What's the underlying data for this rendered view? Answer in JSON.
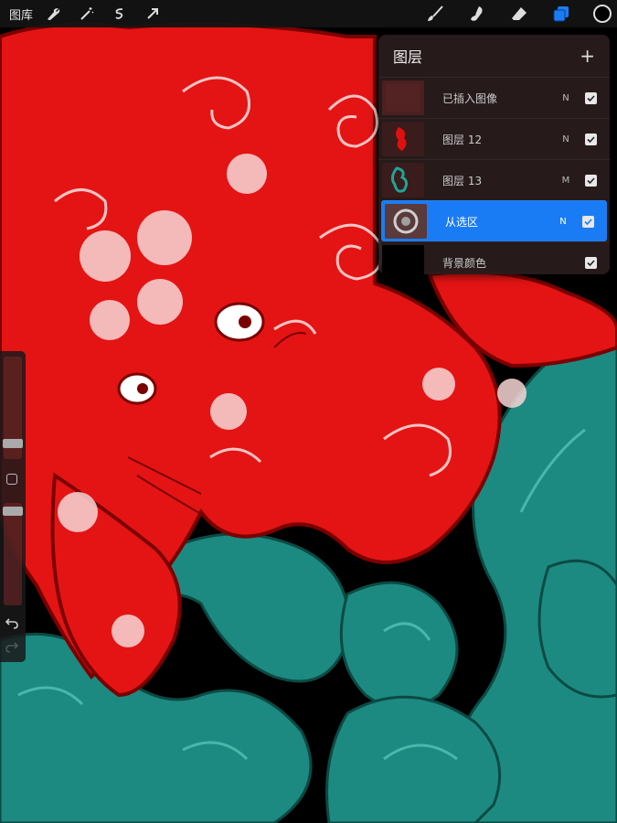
{
  "toolbar": {
    "gallery_label": "图库",
    "left_icons": [
      "wrench-icon",
      "magic-wand-icon",
      "selection-icon",
      "transform-arrow-icon"
    ],
    "right_icons": [
      "brush-icon",
      "smudge-icon",
      "eraser-icon",
      "layers-icon"
    ],
    "current_color": "#000000"
  },
  "layers_panel": {
    "title": "图层",
    "add_label": "+",
    "layers": [
      {
        "name": "已插入图像",
        "blend": "N",
        "visible": true,
        "selected": false
      },
      {
        "name": "图层 12",
        "blend": "N",
        "visible": true,
        "selected": false
      },
      {
        "name": "图层 13",
        "blend": "M",
        "visible": true,
        "selected": false
      },
      {
        "name": "从选区",
        "blend": "N",
        "visible": true,
        "selected": true
      },
      {
        "name": "背景颜色",
        "blend": "",
        "visible": true,
        "selected": false
      }
    ]
  },
  "colors": {
    "accent": "#1a7cf5",
    "red": "#e01010",
    "teal": "#1a8a80",
    "background": "#000000"
  }
}
